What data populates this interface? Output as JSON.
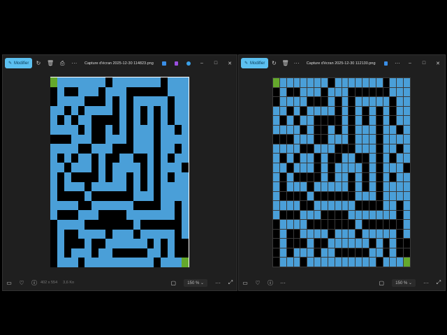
{
  "colors": {
    "path": "#4a9fd8",
    "wall": "#000000",
    "endpoint": "#64a82c",
    "accent": "#5cc0f0"
  },
  "window1": {
    "edit_label": "Modifier",
    "title": "Capture d'écran 2025-12-30 114823.png",
    "dimensions": "402 x 554",
    "size": "3,6 Ko",
    "zoom": "150 %"
  },
  "window2": {
    "edit_label": "Modifier",
    "title": "Capture d'écran 2025-12-30 112130.png",
    "zoom": "150 %"
  },
  "maze": {
    "legend": "0=path 1=wall G=endpoint",
    "rows": [
      "G0000000100000001000",
      "10110001000111111000",
      "10000111010100000100",
      "00101000010101010100",
      "01010011110101010100",
      "00001011010100010010",
      "11100011000100010000",
      "00001100011100010010",
      "01010010110011010100",
      "00100010100001010001",
      "01011110100101010100",
      "01000100000101010000",
      "01111011111100010000",
      "00001100000011110010",
      "01110001111000000010",
      "10000111111101111110",
      "10110000100010000010",
      "10111011000000101011",
      "10100010011111001011",
      "1000100000000001000G"
    ]
  }
}
